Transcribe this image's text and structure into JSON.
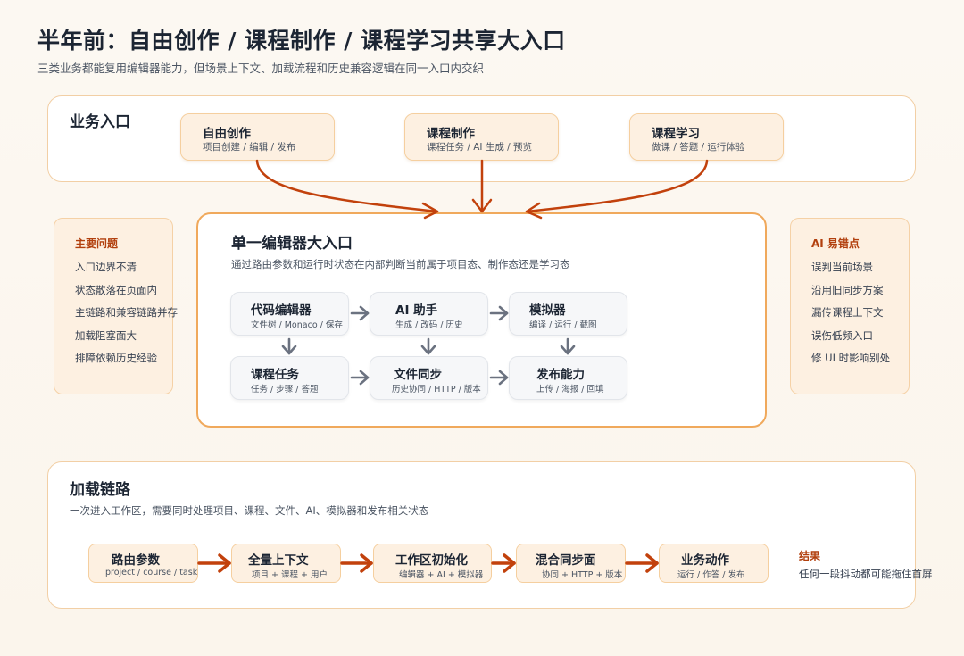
{
  "header": {
    "title": "半年前：自由创作 / 课程制作 / 课程学习共享大入口",
    "subtitle": "三类业务都能复用编辑器能力，但场景上下文、加载流程和历史兼容逻辑在同一入口内交织"
  },
  "business_entry": {
    "title": "业务入口",
    "chips": [
      {
        "title": "自由创作",
        "sub": "项目创建 / 编辑 / 发布"
      },
      {
        "title": "课程制作",
        "sub": "课程任务 / AI 生成 / 预览"
      },
      {
        "title": "课程学习",
        "sub": "做课 / 答题 / 运行体验"
      }
    ]
  },
  "main_problems": {
    "title": "主要问题",
    "items": [
      "入口边界不清",
      "状态散落在页面内",
      "主链路和兼容链路并存",
      "加载阻塞面大",
      "排障依赖历史经验"
    ]
  },
  "ai_pitfalls": {
    "title": "AI 易错点",
    "items": [
      "误判当前场景",
      "沿用旧同步方案",
      "漏传课程上下文",
      "误伤低频入口",
      "修 UI 时影响别处"
    ]
  },
  "editor_entry": {
    "title": "单一编辑器大入口",
    "subtitle": "通过路由参数和运行时状态在内部判断当前属于项目态、制作态还是学习态",
    "nodes": [
      {
        "title": "代码编辑器",
        "sub": "文件树 / Monaco / 保存"
      },
      {
        "title": "AI 助手",
        "sub": "生成 / 改码 / 历史"
      },
      {
        "title": "模拟器",
        "sub": "编译 / 运行 / 截图"
      },
      {
        "title": "课程任务",
        "sub": "任务 / 步骤 / 答题"
      },
      {
        "title": "文件同步",
        "sub": "历史协同 / HTTP / 版本"
      },
      {
        "title": "发布能力",
        "sub": "上传 / 海报 / 回填"
      }
    ]
  },
  "load_chain": {
    "title": "加载链路",
    "subtitle": "一次进入工作区，需要同时处理项目、课程、文件、AI、模拟器和发布相关状态",
    "steps": [
      {
        "title": "路由参数",
        "sub": "project / course / task"
      },
      {
        "title": "全量上下文",
        "sub": "项目 + 课程 + 用户"
      },
      {
        "title": "工作区初始化",
        "sub": "编辑器 + AI + 模拟器"
      },
      {
        "title": "混合同步面",
        "sub": "协同 + HTTP + 版本"
      },
      {
        "title": "业务动作",
        "sub": "运行 / 作答 / 发布"
      }
    ],
    "result_title": "结果",
    "result_text": "任何一段抖动都可能拖住首屏"
  },
  "colors": {
    "accent_arrow": "#c2410c",
    "gray_arrow": "#6b7280",
    "panel_border": "#f2cfa5",
    "center_border": "#f0a95c",
    "chip_fill": "#fdf0e1",
    "warning_text": "#b2400e"
  }
}
